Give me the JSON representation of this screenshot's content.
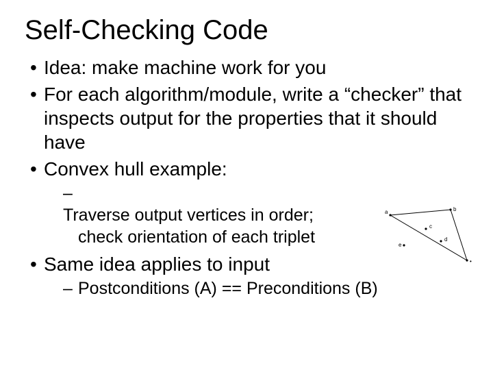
{
  "title": "Self-Checking Code",
  "bullets": {
    "b1": "Idea: make machine work for you",
    "b2": "For each algorithm/module, write a “checker” that inspects output for the properties that it should have",
    "b3": "Convex hull example:",
    "b3_s1_l1": "Traverse output vertices in order;",
    "b3_s1_l2": "check orientation of each triplet",
    "b4": "Same idea applies to input",
    "b4_s1": "Postconditions (A) == Preconditions (B)"
  },
  "diagram": {
    "labels": {
      "a": "a",
      "b": "b",
      "c": "c",
      "d": "d",
      "e": "e"
    }
  }
}
